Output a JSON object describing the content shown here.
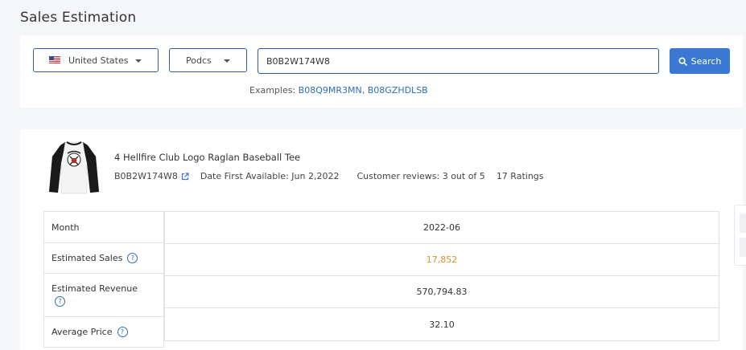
{
  "page": {
    "title": "Sales Estimation"
  },
  "search": {
    "country": "United States",
    "category": "Podcs",
    "query": "B0B2W174W8",
    "button_label": "Search",
    "examples_label": "Examples:",
    "examples": "B08Q9MR3MN, B08GZHDLSB"
  },
  "product": {
    "title": "4 Hellfire Club Logo Raglan Baseball Tee",
    "asin": "B0B2W174W8",
    "date_first_available": "Date First Available: Jun 2,2022",
    "reviews": "Customer reviews: 3 out of 5",
    "ratings": "17 Ratings"
  },
  "table": {
    "rows": [
      {
        "label": "Month",
        "value": "2022-06"
      },
      {
        "label": "Estimated Sales",
        "value": "17,852"
      },
      {
        "label": "Estimated Revenue",
        "value": "570,794.83"
      },
      {
        "label": "Average Price",
        "value": "32.10"
      }
    ]
  },
  "icons": {
    "search": "search-icon",
    "external_link": "external-link-icon",
    "help": "help-circle-icon",
    "dropdown": "chevron-down-icon",
    "flag": "us-flag-icon"
  },
  "colors": {
    "accent": "#3a78d4",
    "link": "#2f6db3",
    "sales_highlight": "#e0912a",
    "border": "#2f5f9e"
  }
}
